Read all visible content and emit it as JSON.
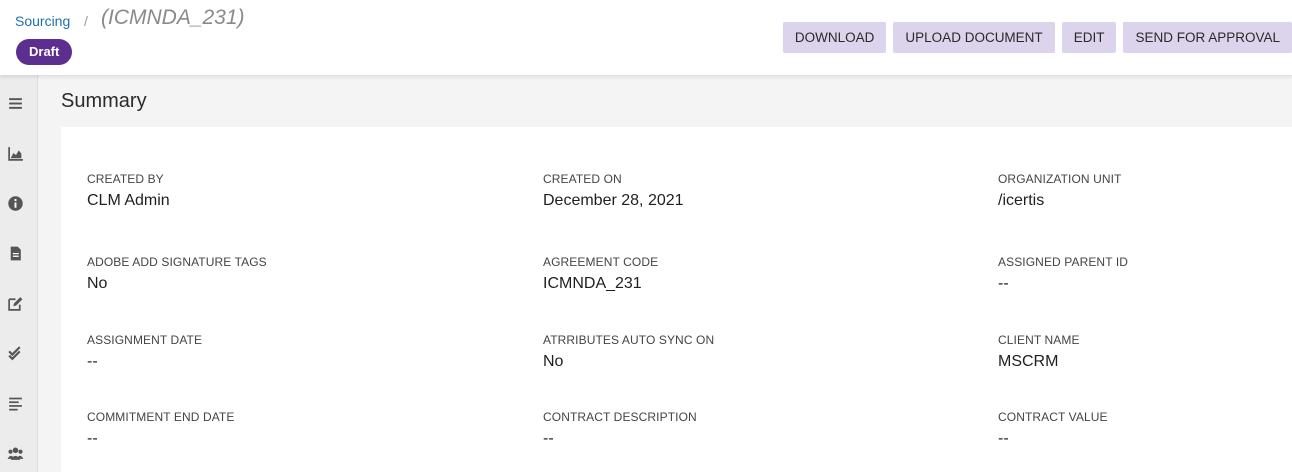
{
  "breadcrumb": {
    "parent": "Sourcing",
    "separator": "/",
    "current": "(ICMNDA_231)"
  },
  "status_badge": "Draft",
  "actions": {
    "download": "DOWNLOAD",
    "upload_document": "UPLOAD DOCUMENT",
    "edit": "EDIT",
    "send_for_approval": "SEND FOR APPROVAL"
  },
  "sidebar_icons": [
    "menu-icon",
    "chart-icon",
    "info-icon",
    "document-icon",
    "edit-icon",
    "approve-icon",
    "list-icon",
    "people-icon"
  ],
  "section_title": "Summary",
  "fields": [
    {
      "label": "CREATED BY",
      "value": "CLM Admin"
    },
    {
      "label": "CREATED ON",
      "value": "December 28, 2021"
    },
    {
      "label": "ORGANIZATION UNIT",
      "value": "/icertis"
    },
    {
      "label": "ADOBE ADD SIGNATURE TAGS",
      "value": "No"
    },
    {
      "label": "AGREEMENT CODE",
      "value": "ICMNDA_231"
    },
    {
      "label": "ASSIGNED PARENT ID",
      "value": "--"
    },
    {
      "label": "ASSIGNMENT DATE",
      "value": "--"
    },
    {
      "label": "ATRRIBUTES AUTO SYNC ON",
      "value": "No"
    },
    {
      "label": "CLIENT NAME",
      "value": "MSCRM"
    },
    {
      "label": "COMMITMENT END DATE",
      "value": "--"
    },
    {
      "label": "CONTRACT DESCRIPTION",
      "value": "--"
    },
    {
      "label": "CONTRACT VALUE",
      "value": "--"
    }
  ],
  "colors": {
    "accent": "#5b2e8f",
    "button_bg": "#dcd3ec",
    "link": "#1f6fb2"
  }
}
